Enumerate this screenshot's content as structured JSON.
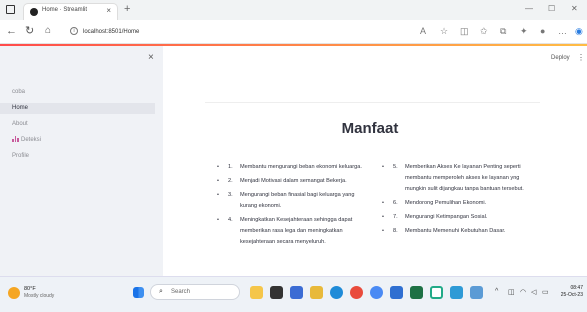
{
  "browser": {
    "tab_title": "Home · Streamlit",
    "tab_close": "×",
    "new_tab": "+",
    "url": "localhost:8501/Home",
    "window_controls": [
      "—",
      "☐",
      "✕"
    ]
  },
  "app": {
    "deploy_label": "Deploy",
    "menu_label": "⋮",
    "sidebar_close": "×",
    "nav": [
      "coba",
      "Home",
      "About",
      "Deteksi",
      "Profile"
    ],
    "active_nav": "Home"
  },
  "main": {
    "title": "Manfaat",
    "benefits_left": [
      {
        "num": "1.",
        "text": "Membantu mengurangi beban ekonomi keluarga."
      },
      {
        "num": "2.",
        "text": "Menjadi Motivasi dalam semangat Bekerja."
      },
      {
        "num": "3.",
        "text": "Mengurangi beban finasial bagi keluarga yang kurang ekonomi."
      },
      {
        "num": "4.",
        "text": "Meningkatkan Kesejahteraan sehingga dapat memberikan rasa lega dan meningkatkan kesejahteraan secara menyeluruh."
      }
    ],
    "benefits_right": [
      {
        "num": "5.",
        "text": "Memberikan Akses Ke layanan Penting seperti membantu memperoleh akses ke layanan yng mungkin sulit dijangkau tanpa bantuan tersebut."
      },
      {
        "num": "6.",
        "text": "Mendorong Pemulihan Ekonomi."
      },
      {
        "num": "7.",
        "text": "Mengurangi Ketimpangan Sosial."
      },
      {
        "num": "8.",
        "text": "Membantu Memenuhi Kebutuhan Dasar."
      }
    ]
  },
  "taskbar": {
    "temp": "80°F",
    "condition": "Mostly cloudy",
    "search_label": "Search",
    "time": "08:47",
    "date": "25-Oct-23"
  },
  "colors": {
    "accent_start": "#ff4b4b",
    "accent_end": "#ffbd45",
    "sidebar_bg": "#f0f2f6",
    "nav_icon": "#c85a9c"
  }
}
